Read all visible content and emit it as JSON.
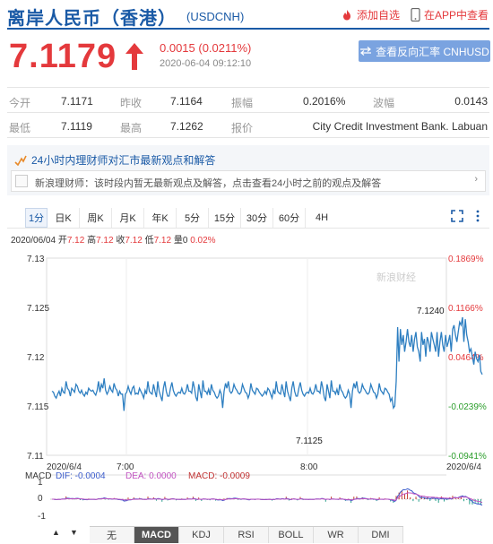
{
  "header": {
    "title": "离岸人民币（香港）",
    "code": "(USDCNH)",
    "favorite_label": "添加自选",
    "app_label": "在APP中查看"
  },
  "quote": {
    "price": "7.1179",
    "change": "0.0015 (0.0211%)",
    "timestamp": "2020-06-04 09:12:10",
    "reverse_button": "查看反向汇率 CNHUSD"
  },
  "stats": {
    "row1": [
      {
        "label": "今开",
        "value": "7.1171"
      },
      {
        "label": "昨收",
        "value": "7.1164"
      },
      {
        "label": "振幅",
        "value": "0.2016%"
      },
      {
        "label": "波幅",
        "value": "0.0143"
      }
    ],
    "row2": [
      {
        "label": "最低",
        "value": "7.1119"
      },
      {
        "label": "最高",
        "value": "7.1262"
      },
      {
        "label": "报价",
        "value": "City Credit Investment Bank. Labuan"
      }
    ]
  },
  "news": {
    "title": "24小时内理财师对汇市最新观点和解答",
    "message": "新浪理财师：该时段内暂无最新观点及解答，点击查看24小时之前的观点及解答"
  },
  "tabs": [
    "1分",
    "日K",
    "周K",
    "月K",
    "年K",
    "5分",
    "15分",
    "30分",
    "60分",
    "4H"
  ],
  "ohlc": {
    "date": "2020/06/04",
    "open_label": "开",
    "open": "7.12",
    "high_label": "高",
    "high": "7.12",
    "close_label": "收",
    "close": "7.12",
    "low_label": "低",
    "low": "7.12",
    "volume_label": "量",
    "volume": "0",
    "pct": "0.02%"
  },
  "watermark": "新浪财经",
  "chart_data": {
    "type": "line",
    "yticks": [
      "7.13",
      "7.125",
      "7.12",
      "7.115",
      "7.11"
    ],
    "pct_ticks": [
      "0.1869%",
      "0.1166%",
      "0.0464%",
      "-0.0239%",
      "-0.0941%"
    ],
    "xticks": [
      "2020/6/4",
      "7:00",
      "8:00",
      "2020/6/4"
    ],
    "ylim": [
      7.11,
      7.13
    ],
    "annotations": [
      {
        "label": "7.1240"
      },
      {
        "label": "7.1125"
      }
    ],
    "series": [
      {
        "values": [
          7.1165,
          7.1164,
          7.116,
          7.1158,
          7.1162,
          7.1165,
          7.116,
          7.1168,
          7.1164,
          7.1163,
          7.1175,
          7.1168,
          7.1166,
          7.116,
          7.1168,
          7.1166,
          7.1164,
          7.1172,
          7.117,
          7.1165,
          7.1163,
          7.1166,
          7.1162,
          7.116,
          7.1164,
          7.1162,
          7.1168,
          7.1166,
          7.1165,
          7.1166,
          7.1163,
          7.1161,
          7.1166,
          7.1175,
          7.1164,
          7.1172,
          7.1168,
          7.1178,
          7.1166,
          7.1162,
          7.1165,
          7.117,
          7.1166,
          7.1164,
          7.1173,
          7.1168,
          7.1166,
          7.116,
          7.1165,
          7.1162,
          7.1162,
          7.1145,
          7.1162,
          7.1164,
          7.117,
          7.1165,
          7.1162,
          7.1168,
          7.117,
          7.1162,
          7.1163,
          7.1162,
          7.1168,
          7.1165,
          7.1162,
          7.1158,
          7.1166,
          7.1162,
          7.1175,
          7.1165,
          7.1163,
          7.1162,
          7.1172,
          7.1165,
          7.1159,
          7.1175,
          7.1165,
          7.116,
          7.1155,
          7.1168,
          7.1175,
          7.1165,
          7.116,
          7.116,
          7.1168,
          7.1174,
          7.1166,
          7.1162,
          7.116,
          7.1163,
          7.1164,
          7.1163,
          7.1168,
          7.1163,
          7.1162,
          7.1165,
          7.1172,
          7.1165,
          7.1165,
          7.1163,
          7.1175,
          7.1168,
          7.1159,
          7.1155,
          7.1172,
          7.1165,
          7.1158,
          7.1176,
          7.1165,
          7.1165,
          7.1162,
          7.1167,
          7.1161,
          7.1172,
          7.1166,
          7.1164,
          7.116,
          7.1158,
          7.116,
          7.1166,
          7.1162,
          7.1148,
          7.1165,
          7.1173,
          7.1168,
          7.1175,
          7.1165,
          7.1163,
          7.1165,
          7.1172,
          7.1168,
          7.1166,
          7.1163,
          7.1162,
          7.1164,
          7.1172,
          7.1168,
          7.1164,
          7.1163,
          7.1158,
          7.1162,
          7.1173,
          7.1166,
          7.1164,
          7.1162,
          7.1168,
          7.1167,
          7.1164,
          7.1162,
          7.116,
          7.1162,
          7.1165,
          7.1162,
          7.1168,
          7.1166,
          7.1162,
          7.1158,
          7.1166,
          7.1162,
          7.1175,
          7.1165,
          7.1163,
          7.1162,
          7.1172,
          7.1165,
          7.1159,
          7.1175,
          7.1165,
          7.116,
          7.1155,
          7.1168,
          7.1175,
          7.1165,
          7.116,
          7.116,
          7.1168,
          7.1174,
          7.1166,
          7.1162,
          7.116,
          7.1163,
          7.1164,
          7.1163,
          7.1168,
          7.1163,
          7.1162,
          7.1165,
          7.1172,
          7.1165,
          7.1165,
          7.1163,
          7.1175,
          7.1168,
          7.1159,
          7.1155,
          7.1172,
          7.1165,
          7.1158,
          7.1176,
          7.1165,
          7.1165,
          7.1162,
          7.1167,
          7.1161,
          7.1172,
          7.1166,
          7.1164,
          7.116,
          7.1158,
          7.116,
          7.1166,
          7.1162,
          7.1148,
          7.1165,
          7.1173,
          7.1168,
          7.1175,
          7.1165,
          7.1163,
          7.1165,
          7.1172,
          7.1168,
          7.1166,
          7.1163,
          7.1162,
          7.1164,
          7.1172,
          7.1168,
          7.1164,
          7.1163,
          7.1158,
          7.1162,
          7.1173,
          7.1166,
          7.1164,
          7.1162,
          7.1168,
          7.1167,
          7.1164,
          7.1162,
          7.1155,
          7.1158,
          7.1148,
          7.115,
          7.1175,
          7.123,
          7.1195,
          7.1228,
          7.1212,
          7.1222,
          7.1205,
          7.1215,
          7.1228,
          7.1215,
          7.121,
          7.1222,
          7.1205,
          7.1218,
          7.1225,
          7.121,
          7.1205,
          7.1195,
          7.1225,
          7.1212,
          7.1218,
          7.12,
          7.122,
          7.1215,
          7.1205,
          7.1225,
          7.1218,
          7.1212,
          7.1205,
          7.1225,
          7.12,
          7.1215,
          7.1225,
          7.1212,
          7.1205,
          7.1222,
          7.121,
          7.1215,
          7.1222,
          7.1205,
          7.1228,
          7.1232,
          7.1222,
          7.1215,
          7.1225,
          7.1235,
          7.1232,
          7.124,
          7.1215,
          7.1238,
          7.1222,
          7.1215,
          7.1205,
          7.1208,
          7.12,
          7.1192,
          7.1205,
          7.1198,
          7.1195,
          7.1202,
          7.1185,
          7.1182
        ]
      }
    ]
  },
  "macd": {
    "label": "MACD",
    "dif": "DIF: -0.0004",
    "dea": "DEA: 0.0000",
    "macd": "MACD: -0.0009",
    "yticks": [
      "1",
      "0",
      "-1"
    ]
  },
  "indicators": [
    "无",
    "MACD",
    "KDJ",
    "RSI",
    "BOLL",
    "WR",
    "DMI"
  ]
}
